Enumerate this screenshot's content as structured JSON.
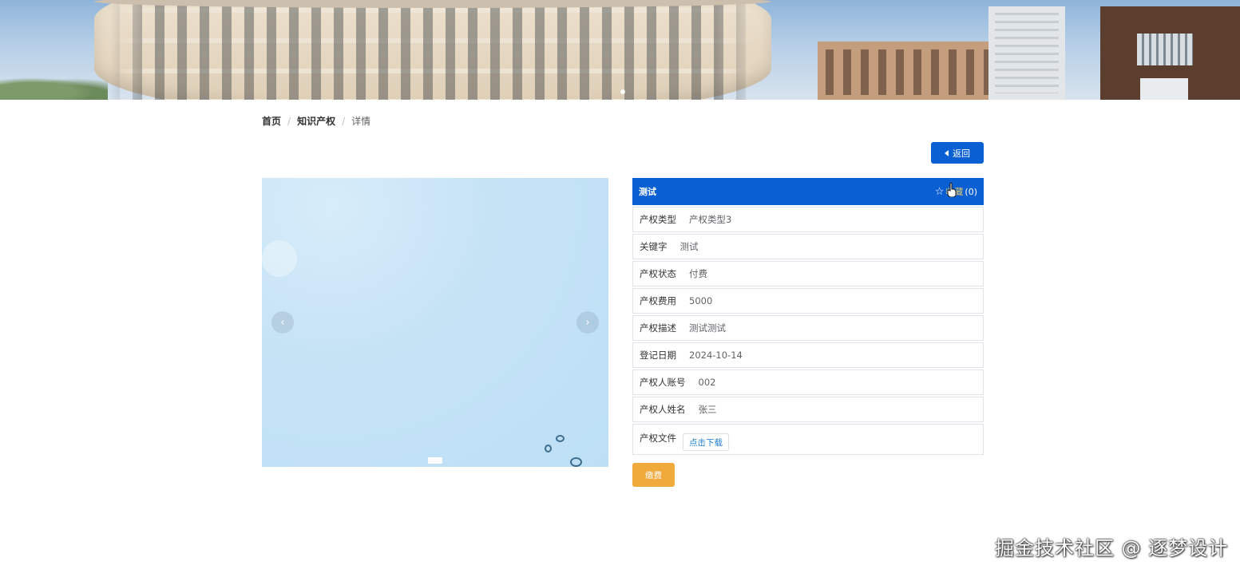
{
  "banner": {
    "slide_count": 1
  },
  "breadcrumb": {
    "home": "首页",
    "section": "知识产权",
    "current": "详情",
    "separator": "/"
  },
  "back_button": {
    "label": "返回",
    "icon": "caret-left-icon"
  },
  "carousel": {
    "prev_label": "‹",
    "next_label": "›",
    "indicator_count": 1,
    "active_index": 0
  },
  "detail": {
    "title": "测试",
    "favorite": {
      "label": "收藏",
      "count": "(0)",
      "icon": "star-outline-icon"
    },
    "fields": [
      {
        "label": "产权类型",
        "value": "产权类型3"
      },
      {
        "label": "关键字",
        "value": "测试"
      },
      {
        "label": "产权状态",
        "value": "付费"
      },
      {
        "label": "产权费用",
        "value": "5000"
      },
      {
        "label": "产权描述",
        "value": "测试测试"
      },
      {
        "label": "登记日期",
        "value": "2024-10-14"
      },
      {
        "label": "产权人账号",
        "value": "002"
      },
      {
        "label": "产权人姓名",
        "value": "张三"
      }
    ],
    "file": {
      "label": "产权文件",
      "download_label": "点击下载"
    },
    "pay_button": "缴费"
  },
  "watermark": "掘金技术社区 @ 逐梦设计",
  "colors": {
    "primary": "#0a5fd3",
    "pay": "#f0a93b",
    "border": "#dfe3e8",
    "text": "#333333",
    "muted": "#606266"
  }
}
